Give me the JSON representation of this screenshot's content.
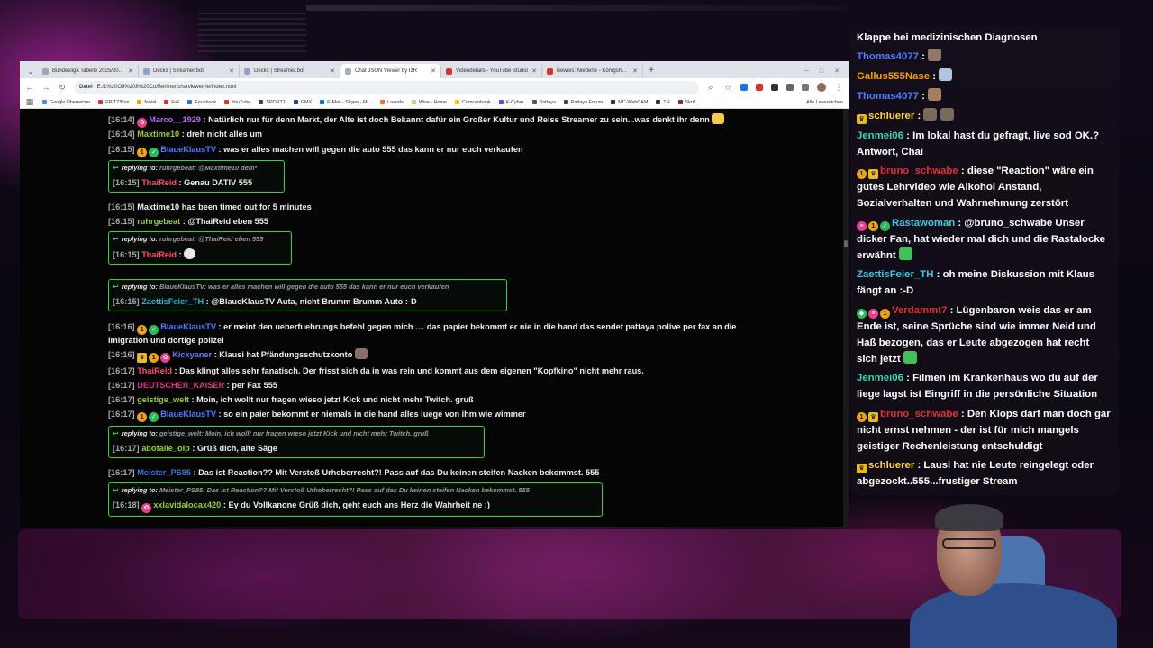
{
  "browser": {
    "tabs": [
      {
        "label": "Bundesliga Tabelle 2025/2026 |",
        "color": "#9aa7b8",
        "active": false
      },
      {
        "label": "Decks | Streamer.bot",
        "color": "#8ba3c7",
        "active": false
      },
      {
        "label": "Decks | Streamer.bot",
        "color": "#8ba3c7",
        "active": false
      },
      {
        "label": "Chat JSON Viewer by IzR",
        "color": "#a8b0bd",
        "active": true
      },
      {
        "label": "Videodetails - YouTube Studio",
        "color": "#e03131",
        "active": false
      },
      {
        "label": "Beweis: Niederle - Königshaus",
        "color": "#e03131",
        "active": false
      }
    ],
    "url_badge": "Datei",
    "url": "E:/1%20OII%208%20Co/Berliner/chatviewer-fe/index.html",
    "bookmarks": [
      {
        "label": "Google Übersetzer",
        "color": "#4a8af4"
      },
      {
        "label": "FRITZ!Box",
        "color": "#e03131"
      },
      {
        "label": "fonial",
        "color": "#f59f00"
      },
      {
        "label": "FvF",
        "color": "#e03131"
      },
      {
        "label": "Facebook",
        "color": "#1877f2"
      },
      {
        "label": "YouTube",
        "color": "#e03131"
      },
      {
        "label": "SPORT1",
        "color": "#444444"
      },
      {
        "label": "GMX",
        "color": "#1c449b"
      },
      {
        "label": "E-Mail - Skype - Mi...",
        "color": "#0078d4"
      },
      {
        "label": "Lazada",
        "color": "#f57224"
      },
      {
        "label": "Wise - Home",
        "color": "#9fe870"
      },
      {
        "label": "Comcenbank",
        "color": "#f7c600"
      },
      {
        "label": "K-Cyber",
        "color": "#7c3aed"
      },
      {
        "label": "Pattaya",
        "color": "#555555"
      },
      {
        "label": "Pattaya Forum",
        "color": "#444444"
      },
      {
        "label": "MC-WebCAM",
        "color": "#333333"
      },
      {
        "label": "TH",
        "color": "#333333"
      },
      {
        "label": "Skrill",
        "color": "#862165"
      }
    ],
    "bookmarks_right": "Alle Lesezeichen"
  },
  "viewer": {
    "messages": [
      {
        "ts": "[16:14]",
        "badges": [
          "pink"
        ],
        "user": "Marco__1929",
        "color": "#b06cff",
        "text": "Natürlich nur für denn Markt, der Alte ist doch Bekannt dafür ein Großer Kultur und Reise Streamer zu sein...was denkt ihr denn",
        "emote": "#f7c948"
      },
      {
        "ts": "[16:14]",
        "badges": [],
        "user": "Maxtime10",
        "color": "#9acd32",
        "text": "dreh nicht alles um"
      },
      {
        "ts": "[16:15]",
        "badges": [
          "mod",
          "verified"
        ],
        "user": "BlaueKlausTV",
        "color": "#4f7dff",
        "text": "was er alles machen will gegen die auto 555 das kann er nur euch verkaufen"
      },
      {
        "ts": "[16:15]",
        "badges": [],
        "user": "Maxtime10 has been timed out for 5 minutes",
        "color": "#eeeeee",
        "text": ""
      },
      {
        "ts": "[16:15]",
        "badges": [],
        "user": "ruhrgebeat",
        "color": "#8fd14f",
        "text": "@ThaiReid eben 555"
      },
      {
        "ts": "[16:16]",
        "badges": [
          "mod",
          "verified"
        ],
        "user": "BlaueKlausTV",
        "color": "#4f7dff",
        "text": "er meint den ueberfuehrungs befehl gegen mich .... das papier bekommt er nie in die hand das sendet pattaya polive per fax an die imigration und dortige polizei"
      },
      {
        "ts": "[16:16]",
        "badges": [
          "crown",
          "mod",
          "pink"
        ],
        "user": "Kickyaner",
        "color": "#5f7cff",
        "text": "Klausi hat Pfändungsschutzkonto",
        "emote": "#8d6e63"
      },
      {
        "ts": "[16:17]",
        "badges": [],
        "user": "ThaiReid",
        "color": "#ff4d6d",
        "text": "Das klingt alles sehr fanatisch. Der frisst sich da in was rein und kommt aus dem eigenen \"Kopfkino\" nicht mehr raus."
      },
      {
        "ts": "[16:17]",
        "badges": [],
        "user": "DEUTSCHER_KAISER",
        "color": "#d63384",
        "text": "per Fax 555"
      },
      {
        "ts": "[16:17]",
        "badges": [],
        "user": "geistige_welt",
        "color": "#9acd32",
        "text": "Moin, ich wollt nur fragen wieso jetzt Kick und nicht mehr Twitch. gruß"
      },
      {
        "ts": "[16:17]",
        "badges": [
          "mod",
          "verified"
        ],
        "user": "BlaueKlausTV",
        "color": "#4f7dff",
        "text": "so ein paier bekommt er niemals in die hand alles luege von ihm wie wimmer"
      },
      {
        "ts": "[16:17]",
        "badges": [],
        "user": "Meister_PS85",
        "color": "#3f6fd8",
        "text": "Das ist Reaction?? Mit Verstoß Urheberrecht?! Pass auf das Du keinen steifen Nacken bekommst. 555"
      }
    ],
    "replies": [
      {
        "reply_label": "replying to:",
        "reply_user": "ruhrgebeat",
        "reply_text": "@Maxtime10 dem*",
        "ts": "[16:15]",
        "badges": [],
        "user": "ThaiReid",
        "color": "#ff4d6d",
        "text": "Genau DATIV 555"
      },
      {
        "reply_label": "replying to:",
        "reply_user": "ruhrgebeat",
        "reply_text": "@ThaiReid eben 555",
        "ts": "[16:15]",
        "badges": [],
        "user": "ThaiReid",
        "color": "#ff4d6d",
        "text": "",
        "emote": "#e8e8e8"
      },
      {
        "reply_label": "replying to:",
        "reply_user": "BlaueKlausTV",
        "reply_text": "was er alles machen will gegen die auto 555 das kann er nur euch verkaufen",
        "ts": "[16:15]",
        "badges": [],
        "user": "ZaettisFeier_TH",
        "color": "#2bb5d6",
        "text": "@BlaueKlausTV Auta, nicht Brumm Brumm Auto :-D"
      },
      {
        "reply_label": "replying to:",
        "reply_user": "geistige_welt",
        "reply_text": "Moin, ich wollt nur fragen wieso jetzt Kick und nicht mehr Twitch. gruß",
        "ts": "[16:17]",
        "badges": [],
        "user": "abofalle_olp",
        "color": "#9acd32",
        "text": "Grüß dich, alte Säge"
      },
      {
        "reply_label": "replying to:",
        "reply_user": "Meister_PS85",
        "reply_text": "Das ist Reaction?? Mit Verstoß Urheberrecht?! Pass auf das Du keinen steifen Nacken bekommst. 555",
        "ts": "[16:18]",
        "badges": [
          "pink"
        ],
        "user": "xxlavidalocax420",
        "color": "#9acd32",
        "text": "Ey du Vollkanone Grüß dich, geht euch ans Herz die Wahrheit ne :)"
      }
    ]
  },
  "overlay": {
    "messages": [
      {
        "badges": [],
        "user": "",
        "color": "#ffffff",
        "text": "Klappe bei medizinischen Diagnosen"
      },
      {
        "badges": [],
        "user": "Thomas4077",
        "color": "#4f7dff",
        "text": "",
        "emotes": [
          "#8d7a6b"
        ]
      },
      {
        "badges": [],
        "user": "Gallus555Nase",
        "color": "#f59f00",
        "text": "",
        "emotes": [
          "#b0c4de"
        ]
      },
      {
        "badges": [],
        "user": "Thomas4077",
        "color": "#4f7dff",
        "text": "",
        "emotes": [
          "#a08060"
        ]
      },
      {
        "badges": [
          "crown"
        ],
        "user": "schluerer",
        "color": "#ffd43b",
        "text": "",
        "emotes": [
          "#7a6a5a",
          "#7a6a5a"
        ]
      },
      {
        "badges": [],
        "user": "Jenmei06",
        "color": "#38d9a9",
        "text": "Im lokal hast du gefragt, live sod OK.? Antwort, Chai"
      },
      {
        "badges": [
          "mod",
          "crown"
        ],
        "user": "bruno_schwabe",
        "color": "#e03131",
        "text": "diese \"Reaction\" wäre ein gutes Lehrvideo wie Alkohol Anstand, Sozialverhalten und Wahrnehmung zerstört"
      },
      {
        "badges": [
          "flag",
          "mod",
          "verified"
        ],
        "user": "Rastawoman",
        "color": "#3bc9db",
        "text": "@bruno_schwabe Unser dicker Fan, hat wieder mal dich und die Rastalocke erwähnt",
        "emotes": [
          "#40c057"
        ]
      },
      {
        "badges": [],
        "user": "ZaettisFeier_TH",
        "color": "#3bc9db",
        "text": "oh meine Diskussion mit Klaus fängt an :-D"
      },
      {
        "badges": [
          "cube",
          "flag",
          "mod"
        ],
        "user": "Verdammt7",
        "color": "#e03131",
        "text": "Lügenbaron weis das er am Ende ist, seine Sprüche sind wie immer Neid und Haß bezogen, das er Leute abgezogen hat recht sich jetzt",
        "emotes": [
          "#40c057"
        ]
      },
      {
        "badges": [],
        "user": "Jenmei06",
        "color": "#38d9a9",
        "text": "Filmen im Krankenhaus wo du auf der liege lagst ist Eingriff in die persönliche Situation"
      },
      {
        "badges": [
          "mod",
          "crown"
        ],
        "user": "bruno_schwabe",
        "color": "#e03131",
        "text": "Den Klops darf man doch gar nicht ernst nehmen - der ist für mich mangels geistiger Rechenleistung entschuldigt"
      },
      {
        "badges": [
          "crown"
        ],
        "user": "schluerer",
        "color": "#ffd43b",
        "text": "Lausi hat nie Leute reingelegt oder abgezockt..555...frustiger Stream"
      }
    ]
  }
}
